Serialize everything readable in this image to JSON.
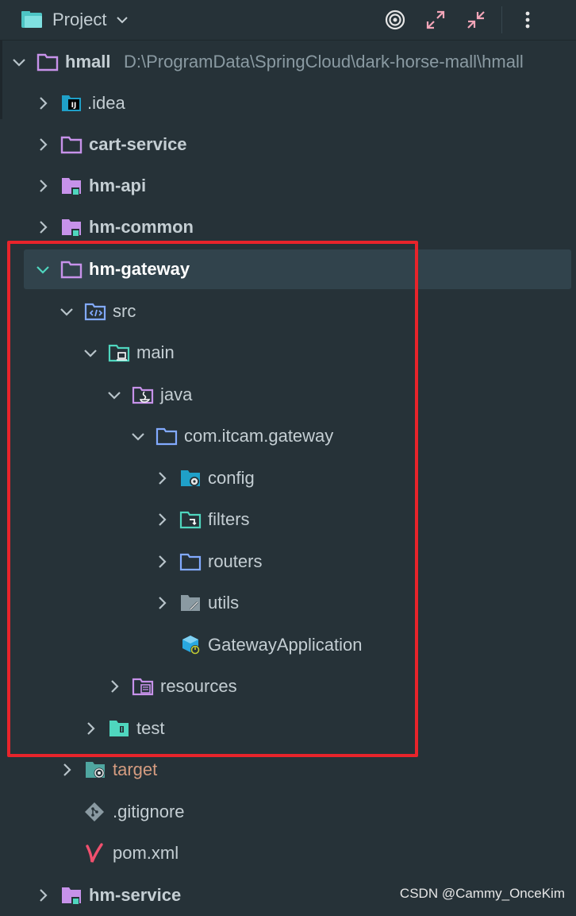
{
  "toolbar": {
    "title": "Project",
    "icons": [
      "folder-icon",
      "chevron-down-icon",
      "target-icon",
      "expand-icon",
      "collapse-icon",
      "more-icon"
    ]
  },
  "tree": {
    "root_name": "hmall",
    "root_path": "D:\\ProgramData\\SpringCloud\\dark-horse-mall\\hmall",
    "idea": ".idea",
    "cart_service": "cart-service",
    "hm_api": "hm-api",
    "hm_common": "hm-common",
    "hm_gateway": "hm-gateway",
    "src": "src",
    "main": "main",
    "java": "java",
    "package": "com.itcam.gateway",
    "config": "config",
    "filters": "filters",
    "routers": "routers",
    "utils": "utils",
    "app_class": "GatewayApplication",
    "resources": "resources",
    "test": "test",
    "target": "target",
    "gitignore": ".gitignore",
    "pom": "pom.xml",
    "hm_service": "hm-service"
  },
  "colors": {
    "background": "#263238",
    "selection": "#31434c",
    "highlight_border": "#e8242b",
    "module_folder": "#c792ea",
    "folder_blue": "#82aaff",
    "folder_teal": "#4fd6be",
    "excluded_orange": "#d59c80"
  },
  "watermark": "CSDN @Cammy_OnceKim"
}
